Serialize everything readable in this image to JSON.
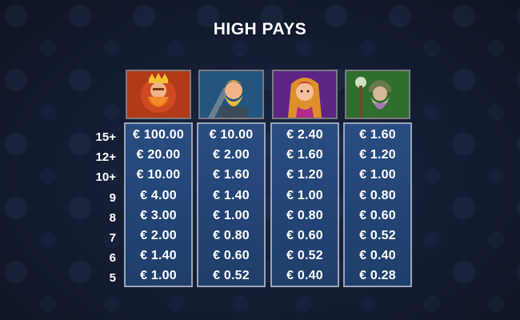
{
  "title": "HIGH PAYS",
  "row_labels": [
    "15+",
    "12+",
    "10+",
    "9",
    "8",
    "7",
    "6",
    "5"
  ],
  "symbols": [
    {
      "icon": "king-dwarf-icon",
      "bg_color": "#c4461c",
      "payouts": [
        "€ 100.00",
        "€ 20.00",
        "€ 10.00",
        "€ 4.00",
        "€ 3.00",
        "€ 2.00",
        "€ 1.40",
        "€ 1.00"
      ]
    },
    {
      "icon": "blond-warrior-dwarf-icon",
      "bg_color": "#2d6a9a",
      "payouts": [
        "€ 10.00",
        "€ 2.00",
        "€ 1.60",
        "€ 1.40",
        "€ 1.00",
        "€ 0.80",
        "€ 0.60",
        "€ 0.52"
      ]
    },
    {
      "icon": "female-dwarf-icon",
      "bg_color": "#7a2fa0",
      "payouts": [
        "€ 2.40",
        "€ 1.60",
        "€ 1.20",
        "€ 1.00",
        "€ 0.80",
        "€ 0.60",
        "€ 0.52",
        "€ 0.40"
      ]
    },
    {
      "icon": "old-wizard-dwarf-icon",
      "bg_color": "#3f8a3a",
      "payouts": [
        "€ 1.60",
        "€ 1.20",
        "€ 1.00",
        "€ 0.80",
        "€ 0.60",
        "€ 0.52",
        "€ 0.40",
        "€ 0.28"
      ]
    }
  ]
}
